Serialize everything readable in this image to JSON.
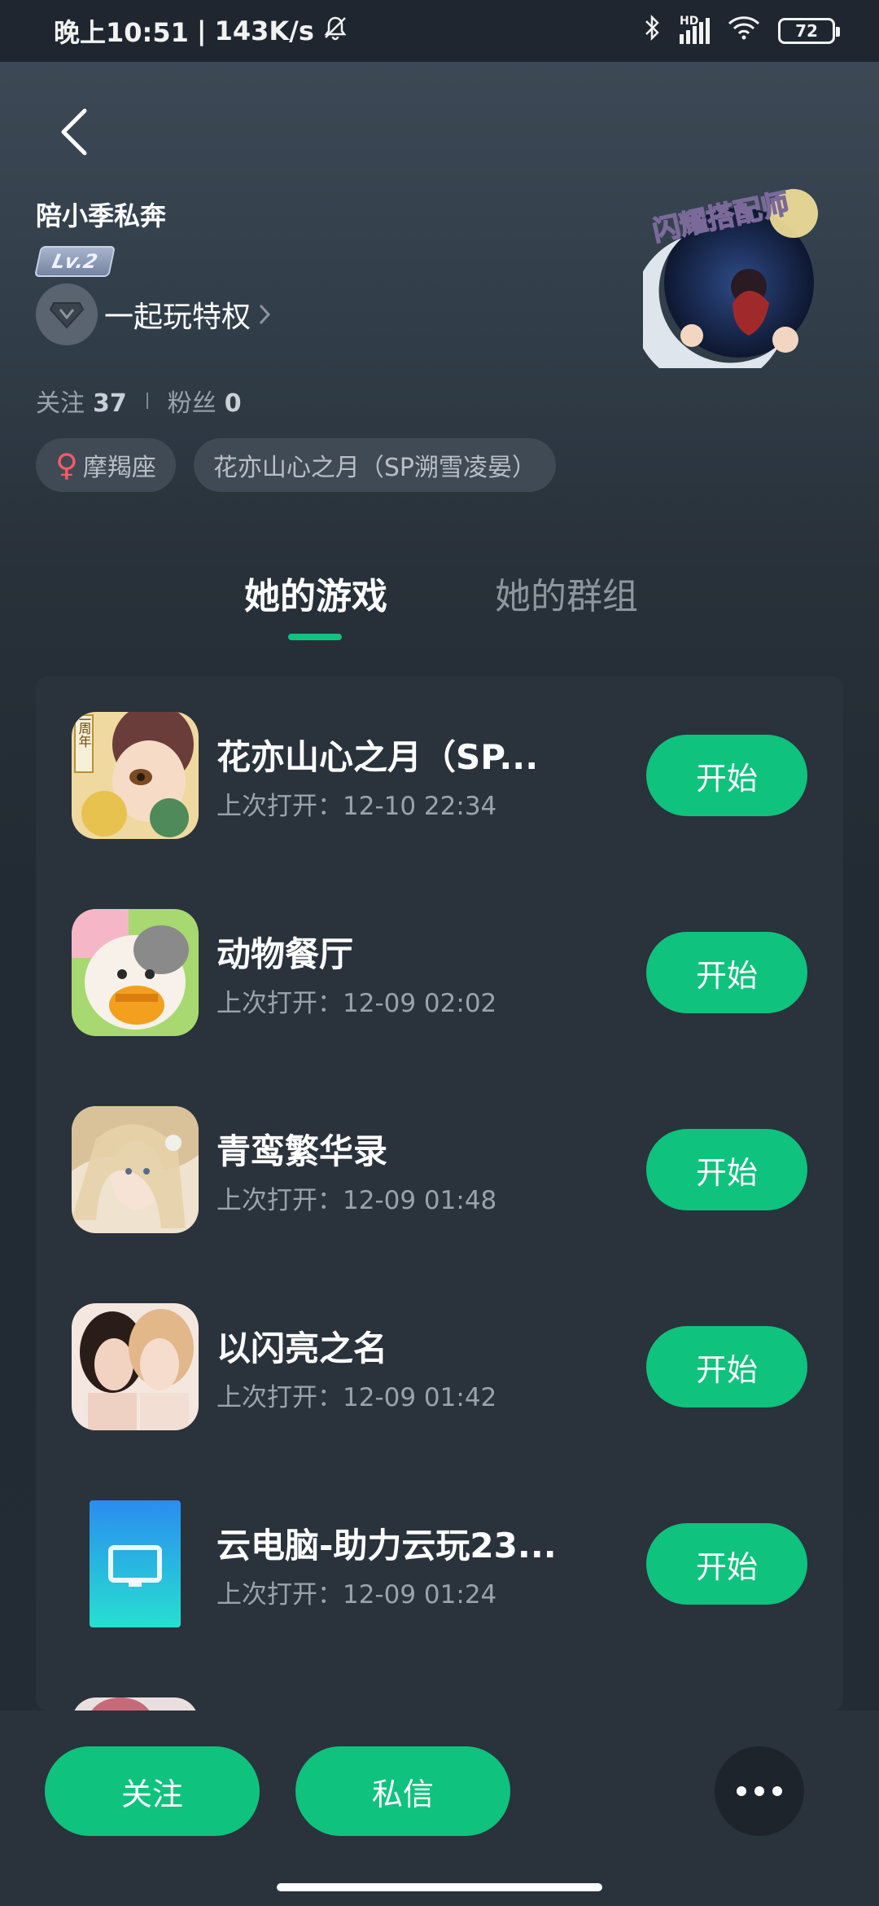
{
  "status_bar": {
    "time": "晚上10:51",
    "speed": "143K/s",
    "network": "HD",
    "battery": "72"
  },
  "profile": {
    "name": "陪小季私奔",
    "level": "Lv.2",
    "privilege_label": "一起玩特权",
    "avatar_text": "闪耀搭配师",
    "following_label": "关注",
    "following_count": "37",
    "followers_label": "粉丝",
    "followers_count": "0",
    "tags": [
      {
        "icon": "female-icon",
        "symbol": "♀",
        "label": "摩羯座"
      },
      {
        "label": "花亦山心之月（SP溯雪凌晏）"
      }
    ]
  },
  "tabs": [
    {
      "label": "她的游戏",
      "active": true
    },
    {
      "label": "她的群组",
      "active": false
    }
  ],
  "games": [
    {
      "title": "花亦山心之月（SP...",
      "last_opened": "上次打开：12-10 22:34",
      "button": "开始",
      "icon_text": "二周年"
    },
    {
      "title": "动物餐厅",
      "last_opened": "上次打开：12-09 02:02",
      "button": "开始"
    },
    {
      "title": "青鸾繁华录",
      "last_opened": "上次打开：12-09 01:48",
      "button": "开始"
    },
    {
      "title": "以闪亮之名",
      "last_opened": "上次打开：12-09 01:42",
      "button": "开始"
    },
    {
      "title": "云电脑-助力云玩23...",
      "last_opened": "上次打开：12-09 01:24",
      "button": "开始"
    }
  ],
  "bottom_actions": {
    "follow": "关注",
    "message": "私信"
  },
  "colors": {
    "accent": "#0fc27d",
    "background": "#232b35",
    "card": "#2a323c"
  }
}
